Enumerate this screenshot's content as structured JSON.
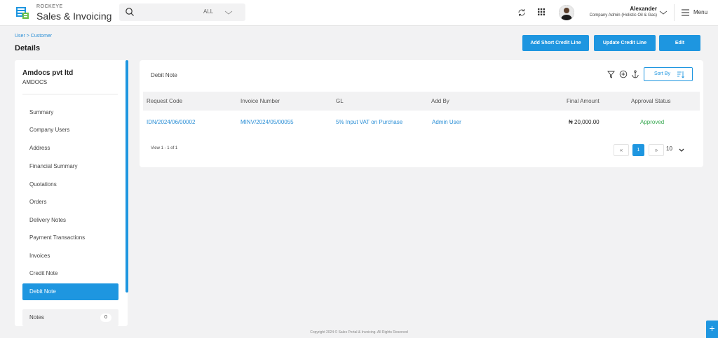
{
  "brand": {
    "small": "ROCKEYE",
    "big": "Sales & Invoicing"
  },
  "search": {
    "value": "",
    "placeholder": "",
    "category": "ALL"
  },
  "user": {
    "name": "Alexander",
    "role": "Company Admin (Holistic Oil & Gas)"
  },
  "menu_label": "Menu",
  "breadcrumb": {
    "root": "User",
    "separator": ">",
    "current": "Customer"
  },
  "page_title": "Details",
  "actions": {
    "add_short_credit_line": "Add Short Credit Line",
    "update_credit_line": "Update Credit Line",
    "edit": "Edit"
  },
  "sidebar": {
    "company_name": "Amdocs pvt ltd",
    "company_code": "AMDOCS",
    "items": [
      {
        "label": "Summary"
      },
      {
        "label": "Company Users"
      },
      {
        "label": "Address"
      },
      {
        "label": "Financial Summary"
      },
      {
        "label": "Quotations"
      },
      {
        "label": "Orders"
      },
      {
        "label": "Delivery Notes"
      },
      {
        "label": "Payment Transactions"
      },
      {
        "label": "Invoices"
      },
      {
        "label": "Credit Note"
      },
      {
        "label": "Debit Note"
      }
    ],
    "active_item": "Debit Note",
    "notes": {
      "label": "Notes",
      "count": "0"
    }
  },
  "panel": {
    "title": "Debit Note",
    "sort_label": "Sort By",
    "columns": [
      "Request Code",
      "Invoice Number",
      "GL",
      "Add By",
      "Final Amount",
      "Approval Status"
    ],
    "rows": [
      {
        "request_code": "IDN/2024/06/00002",
        "invoice_number": "MINV/2024/05/00055",
        "gl": "5% Input VAT on Purchase",
        "add_by": "Admin User",
        "final_amount": "₦ 20,000.00",
        "approval_status": "Approved"
      }
    ],
    "view_count": "View 1 - 1 of 1",
    "pagination": {
      "first": "«",
      "current": "1",
      "last": "»",
      "page_size": "10"
    }
  },
  "footer": "Copyright 2024 © Sales Portal & Invoicing. All Rights Reserved",
  "fab_label": "+",
  "colors": {
    "accent": "#1e96e0",
    "approved": "#3cab55",
    "background": "#f2f2f3"
  }
}
